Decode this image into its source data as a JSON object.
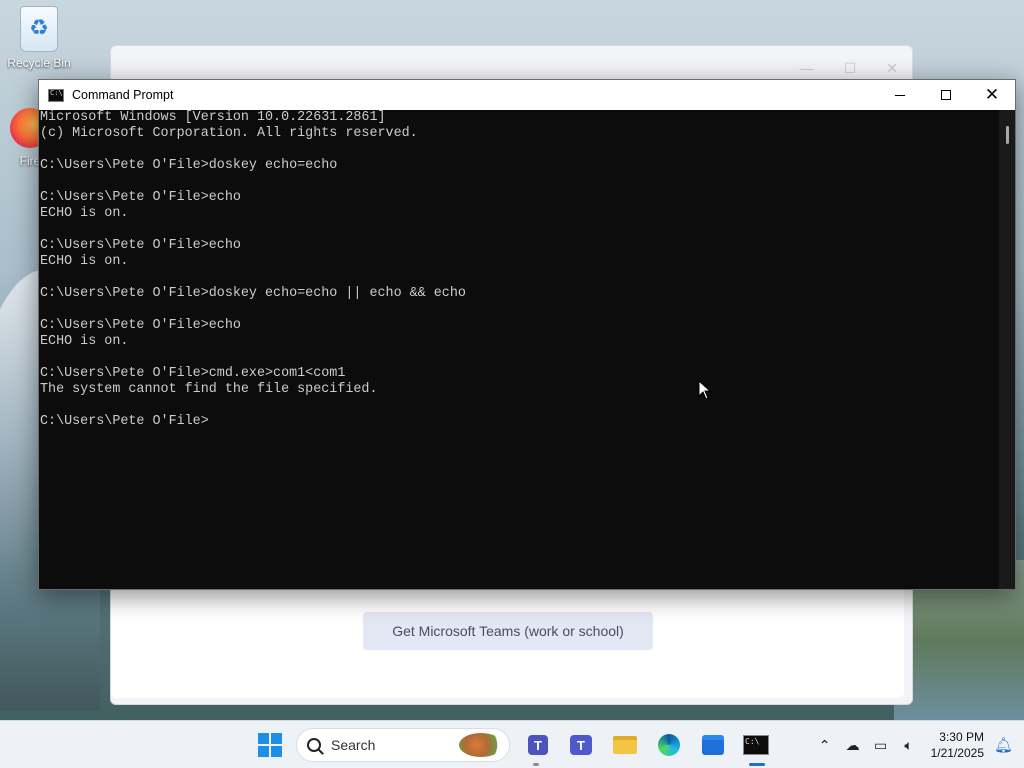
{
  "desktop": {
    "icons": [
      {
        "label": "Recycle Bin"
      },
      {
        "label": "Fire"
      }
    ]
  },
  "background_window": {
    "button_label": "Get Microsoft Teams (work or school)"
  },
  "cmd": {
    "title": "Command Prompt",
    "controls": {
      "minimize": "—",
      "maximize": "☐",
      "close": "✕"
    },
    "lines": [
      "Microsoft Windows [Version 10.0.22631.2861]",
      "(c) Microsoft Corporation. All rights reserved.",
      "",
      "C:\\Users\\Pete O'File>doskey echo=echo",
      "",
      "C:\\Users\\Pete O'File>echo",
      "ECHO is on.",
      "",
      "C:\\Users\\Pete O'File>echo",
      "ECHO is on.",
      "",
      "C:\\Users\\Pete O'File>doskey echo=echo || echo && echo",
      "",
      "C:\\Users\\Pete O'File>echo",
      "ECHO is on.",
      "",
      "C:\\Users\\Pete O'File>cmd.exe>com1<com1",
      "The system cannot find the file specified.",
      "",
      "C:\\Users\\Pete O'File>"
    ]
  },
  "taskbar": {
    "search_label": "Search",
    "clock_time": "3:30 PM",
    "clock_date": "1/21/2025"
  }
}
